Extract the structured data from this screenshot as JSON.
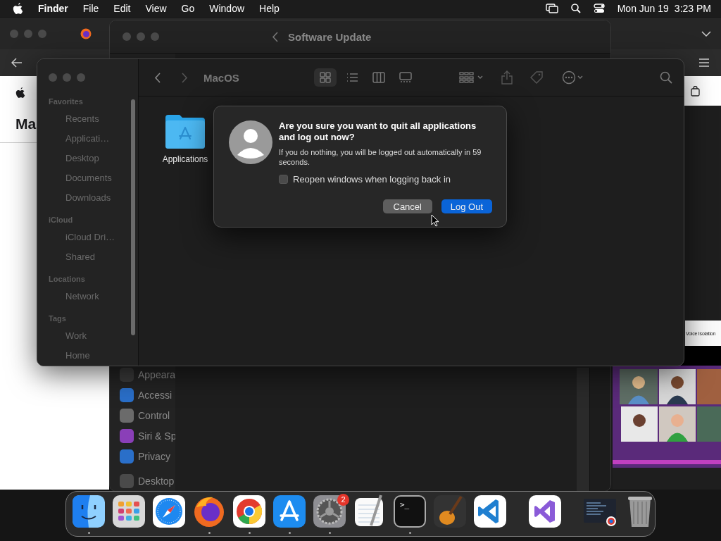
{
  "menu_bar": {
    "app_name": "Finder",
    "menus": [
      "File",
      "Edit",
      "View",
      "Go",
      "Window",
      "Help"
    ],
    "date": "Mon Jun 19",
    "time": "3:23 PM"
  },
  "browser_window": {
    "heading": "Ma",
    "caption": "Voice Isolation"
  },
  "settings_window": {
    "title": "Software Update",
    "sidebar_items": [
      {
        "kind": "appearance",
        "label": "Appeara"
      },
      {
        "kind": "accessibility",
        "label": "Accessi"
      },
      {
        "kind": "control",
        "label": "Control"
      },
      {
        "kind": "siri",
        "label": "Siri & Sp"
      },
      {
        "kind": "privacy",
        "label": "Privacy"
      },
      {
        "kind": "desktop",
        "label": "Desktop"
      }
    ]
  },
  "finder_window": {
    "title": "MacOS",
    "views": [
      {
        "kind": "icons",
        "selected": true
      },
      {
        "kind": "list",
        "selected": false
      },
      {
        "kind": "columns",
        "selected": false
      },
      {
        "kind": "gallery",
        "selected": false
      }
    ],
    "sidebar": [
      {
        "heading": "Favorites",
        "items": [
          "Recents",
          "Applicati…",
          "Desktop",
          "Documents",
          "Downloads"
        ]
      },
      {
        "heading": "iCloud",
        "items": [
          "iCloud Dri…",
          "Shared"
        ]
      },
      {
        "heading": "Locations",
        "items": [
          "Network"
        ]
      },
      {
        "heading": "Tags",
        "items": [
          "Work",
          "Home"
        ]
      }
    ],
    "files": [
      {
        "name": "Applications"
      }
    ]
  },
  "dialog": {
    "title": "Are you sure you want to quit all applications and log out now?",
    "message": "If you do nothing, you will be logged out automatically in 59 seconds.",
    "checkbox": {
      "label": "Reopen windows when logging back in",
      "checked": false
    },
    "buttons": [
      {
        "label": "Cancel",
        "kind": "secondary"
      },
      {
        "label": "Log Out",
        "kind": "primary"
      }
    ]
  },
  "dock": {
    "items": [
      {
        "kind": "finder",
        "running": true
      },
      {
        "kind": "launchpad",
        "running": false
      },
      {
        "kind": "safari",
        "running": false
      },
      {
        "kind": "firefox",
        "running": true
      },
      {
        "kind": "chrome",
        "running": true
      },
      {
        "kind": "appstore",
        "running": true
      },
      {
        "kind": "settings",
        "running": true,
        "badge": "2"
      },
      {
        "kind": "textedit",
        "running": false
      },
      {
        "kind": "terminal",
        "running": true,
        "glyph": ">_"
      },
      {
        "kind": "garageband",
        "running": false
      },
      {
        "kind": "vscode",
        "running": false
      },
      {
        "kind": "separator"
      },
      {
        "kind": "visualstudio",
        "running": false
      },
      {
        "kind": "separator"
      },
      {
        "kind": "window",
        "running": false
      },
      {
        "kind": "trash",
        "running": false
      }
    ]
  }
}
